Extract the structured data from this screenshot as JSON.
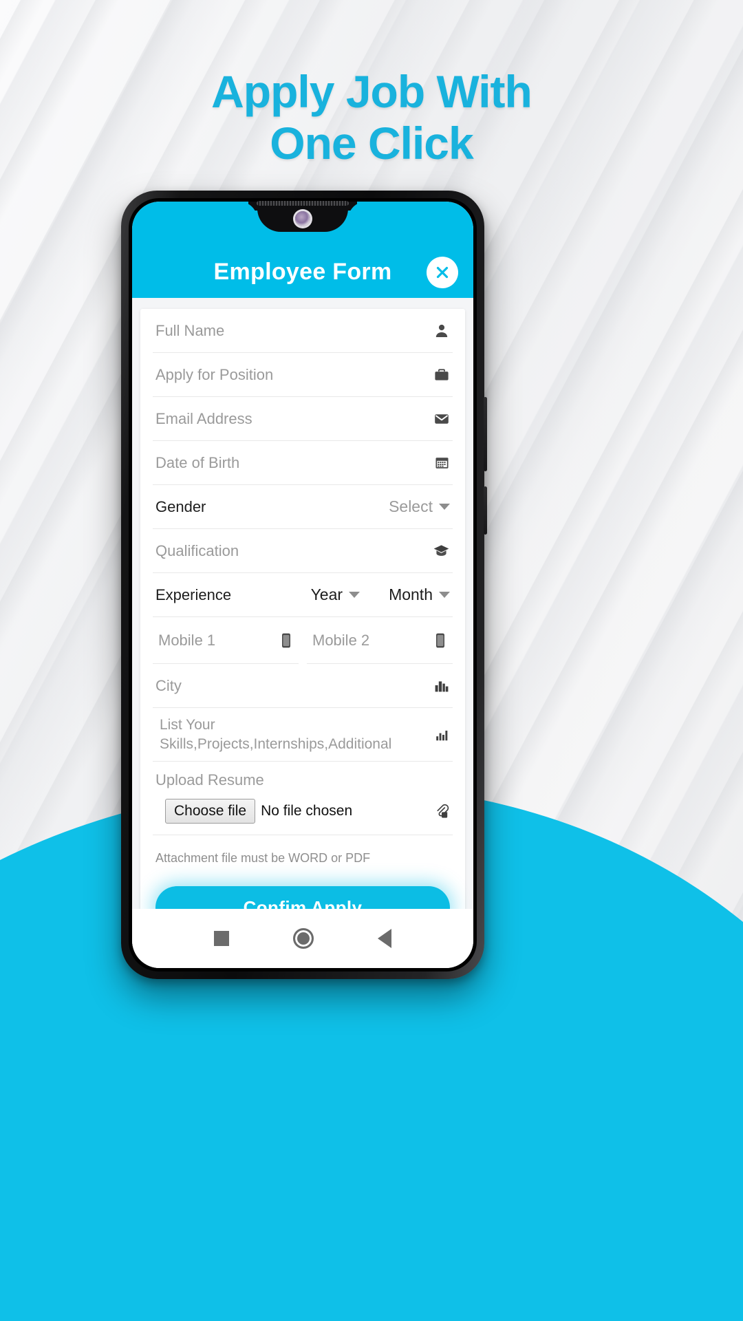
{
  "headline": {
    "line1": "Apply Job With",
    "line2": "One Click"
  },
  "colors": {
    "accent": "#00bde8",
    "button": "#0cbde4",
    "headline": "#19b2dd",
    "wave": "#0fc0e8"
  },
  "app": {
    "title": "Employee Form",
    "close_icon": "close-icon"
  },
  "form": {
    "fields": [
      {
        "label": "Full Name",
        "icon": "person-icon"
      },
      {
        "label": "Apply for Position",
        "icon": "briefcase-icon"
      },
      {
        "label": "Email Address",
        "icon": "envelope-icon"
      },
      {
        "label": "Date of Birth",
        "icon": "calendar-icon"
      }
    ],
    "gender": {
      "label": "Gender",
      "value": "Select"
    },
    "qualification": {
      "label": "Qualification",
      "icon": "graduation-cap-icon"
    },
    "experience": {
      "label": "Experience",
      "year": "Year",
      "month": "Month"
    },
    "mobile1": {
      "label": "Mobile 1",
      "icon": "phone-icon"
    },
    "mobile2": {
      "label": "Mobile 2",
      "icon": "phone-icon"
    },
    "city": {
      "label": "City",
      "icon": "buildings-icon"
    },
    "skills": {
      "line1": "List Your",
      "line2": "Skills,Projects,Internships,Additional",
      "icon": "bar-chart-icon"
    },
    "upload": {
      "label": "Upload Resume",
      "choose_button": "Choose file",
      "file_status": "No file chosen",
      "icon": "paperclip-icon",
      "note": "Attachment file must be WORD or PDF"
    },
    "submit": "Confim Apply"
  },
  "navbar": {
    "recents": "square-icon",
    "home": "circle-icon",
    "back": "triangle-back-icon"
  }
}
